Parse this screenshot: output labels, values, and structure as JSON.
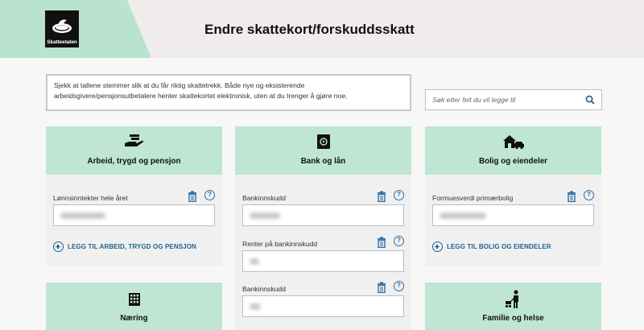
{
  "header": {
    "logo_text": "Skatteetaten",
    "title": "Endre skattekort/forskuddsskatt"
  },
  "info": {
    "text": "Sjekk at tallene stemmer slik at du får riktig skattetrekk. Både nye og eksisterende arbeidsgivere/pensjonsutbetalere henter skattekortet elektronisk, uten at du trenger å gjøre noe."
  },
  "search": {
    "placeholder": "Søk etter felt du vil legge til",
    "icon": "search-icon"
  },
  "colors": {
    "accent_green": "#bfe6d3",
    "link_blue": "#1f5f8b"
  },
  "cards": {
    "arbeid": {
      "title": "Arbeid, trygd og pensjon",
      "icon": "hand-money-icon",
      "fields": [
        {
          "label": "Lønnsinntekter hele året"
        }
      ],
      "add_label": "LEGG TIL ARBEID, TRYGD OG PENSJON"
    },
    "bank": {
      "title": "Bank og lån",
      "icon": "safe-icon",
      "fields": [
        {
          "label": "Bankinnskudd"
        },
        {
          "label": "Renter på bankinnskudd"
        },
        {
          "label": "Bankinnskudd"
        }
      ]
    },
    "bolig": {
      "title": "Bolig og eiendeler",
      "icon": "house-car-icon",
      "fields": [
        {
          "label": "Formuesverdi primærbolig"
        }
      ],
      "add_label": "LEGG TIL BOLIG OG EIENDELER"
    },
    "naering": {
      "title": "Næring",
      "icon": "building-icon"
    },
    "familie": {
      "title": "Familie og helse",
      "icon": "family-stroller-icon"
    }
  }
}
